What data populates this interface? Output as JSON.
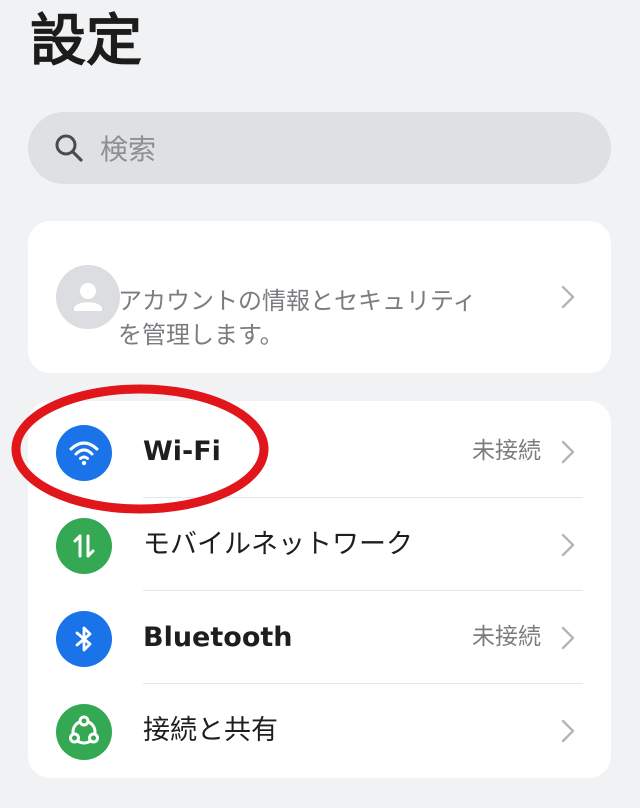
{
  "header": {
    "title": "設定"
  },
  "search": {
    "placeholder": "検索"
  },
  "account": {
    "text_line1": "アカウントの情報とセキュリティ",
    "text_line2": "を管理します。"
  },
  "network": {
    "items": [
      {
        "label": "Wi-Fi",
        "status": "未接続",
        "icon": "wifi-icon",
        "color": "#1a73e8"
      },
      {
        "label": "モバイルネットワーク",
        "status": "",
        "icon": "mobile-data-icon",
        "color": "#34a853"
      },
      {
        "label": "Bluetooth",
        "status": "未接続",
        "icon": "bluetooth-icon",
        "color": "#1a73e8"
      },
      {
        "label": "接続と共有",
        "status": "",
        "icon": "share-icon",
        "color": "#34a853"
      }
    ]
  },
  "annotation": {
    "color": "#e0161b"
  }
}
